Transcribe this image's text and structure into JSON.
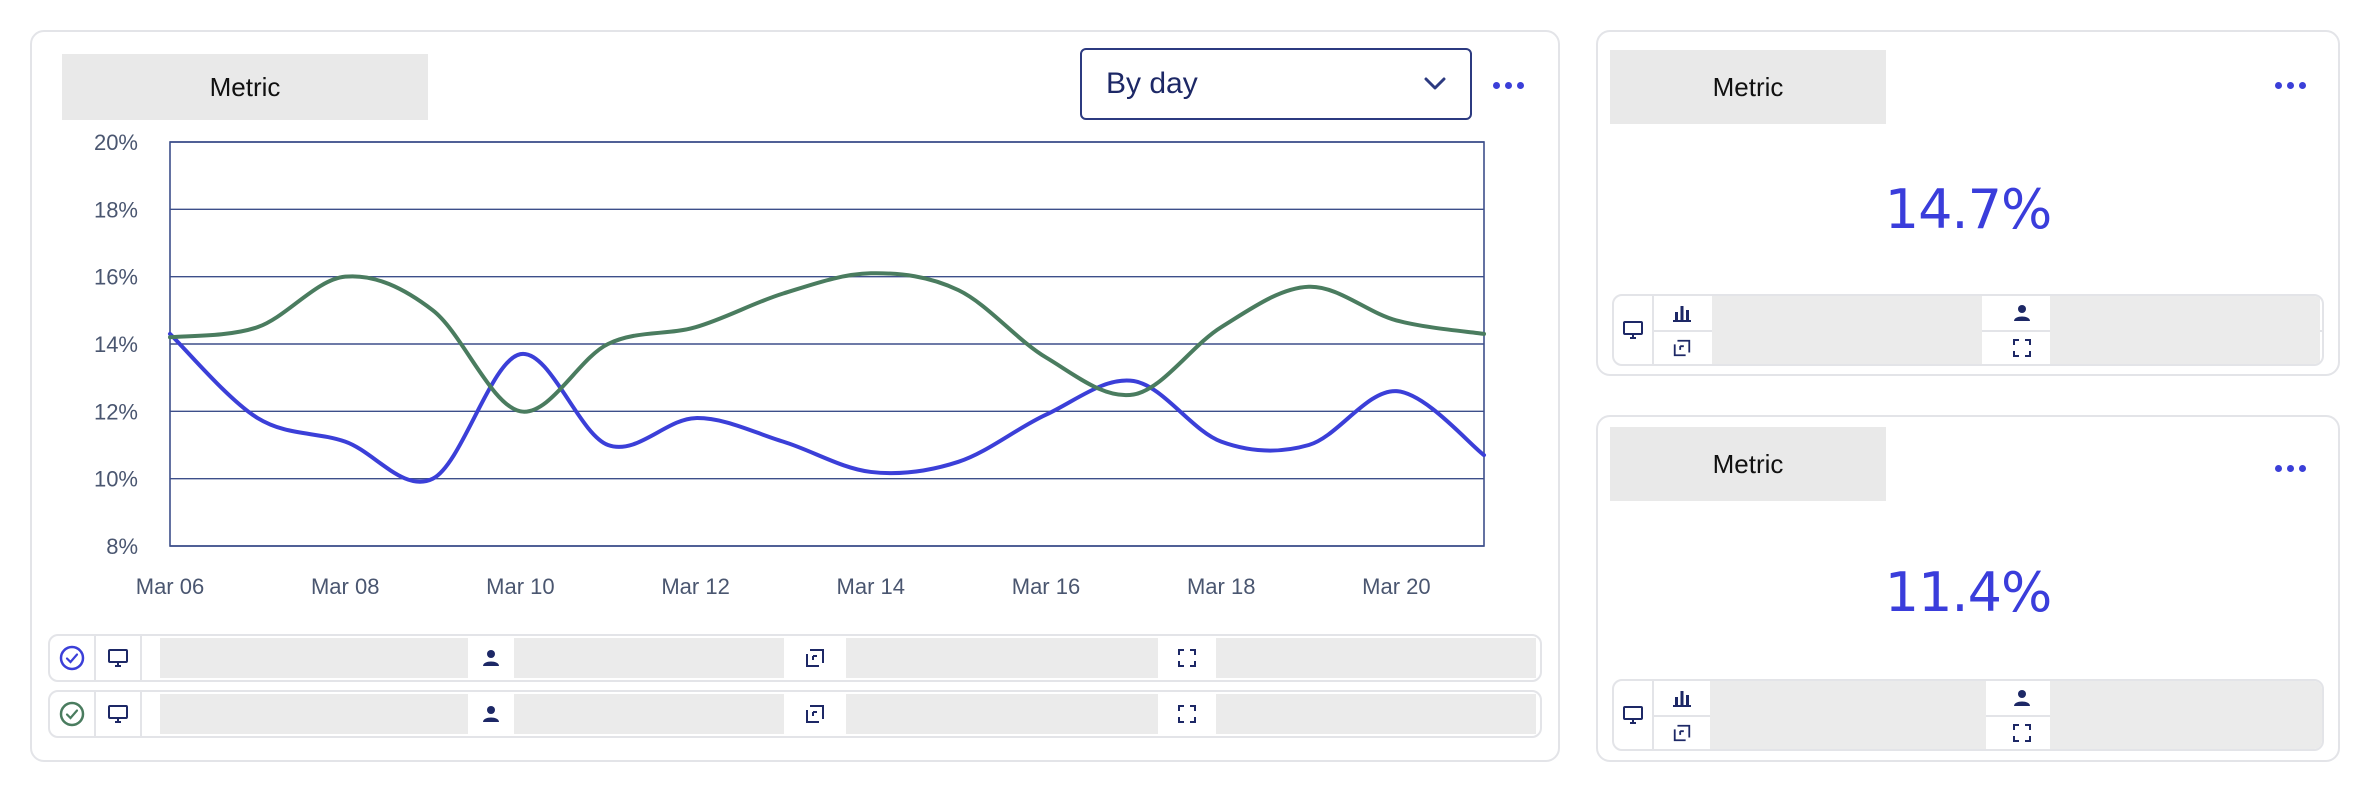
{
  "main_chart_card": {
    "metric_label": "Metric",
    "range_select": {
      "value": "By day"
    },
    "chart_data": {
      "type": "line",
      "x": [
        "Mar 06",
        "Mar 07",
        "Mar 08",
        "Mar 09",
        "Mar 10",
        "Mar 11",
        "Mar 12",
        "Mar 13",
        "Mar 14",
        "Mar 15",
        "Mar 16",
        "Mar 17",
        "Mar 18",
        "Mar 19",
        "Mar 20",
        "Mar 21"
      ],
      "x_tick_labels": [
        "Mar 06",
        "Mar 08",
        "Mar 10",
        "Mar 12",
        "Mar 14",
        "Mar 16",
        "Mar 18",
        "Mar 20"
      ],
      "y_tick_labels": [
        "20%",
        "18%",
        "16%",
        "14%",
        "12%",
        "10%",
        "8%"
      ],
      "ylim": [
        8,
        20
      ],
      "grid": "horizontal",
      "series": [
        {
          "color": "#3b3fd8",
          "values": [
            14.3,
            11.8,
            11.1,
            10.0,
            13.7,
            11.0,
            11.8,
            11.1,
            10.2,
            10.5,
            11.9,
            12.9,
            11.1,
            11.0,
            12.6,
            10.7
          ]
        },
        {
          "color": "#4a7c5f",
          "values": [
            14.2,
            14.5,
            16.0,
            15.0,
            12.0,
            14.0,
            14.5,
            15.5,
            16.1,
            15.6,
            13.6,
            12.5,
            14.5,
            15.7,
            14.7,
            14.3
          ]
        }
      ]
    },
    "rows": [
      {
        "status_icon": "check-circle-icon",
        "status_color": "#3b3fd8"
      },
      {
        "status_icon": "check-circle-icon",
        "status_color": "#4a7c5f"
      }
    ]
  },
  "kpi_cards": [
    {
      "metric_label": "Metric",
      "value": "14.7%"
    },
    {
      "metric_label": "Metric",
      "value": "11.4%"
    }
  ],
  "colors": {
    "accent": "#3b3fd8",
    "secondary_series": "#4a7c5f",
    "border": "#e3e4e8",
    "placeholder": "#ebebeb"
  }
}
